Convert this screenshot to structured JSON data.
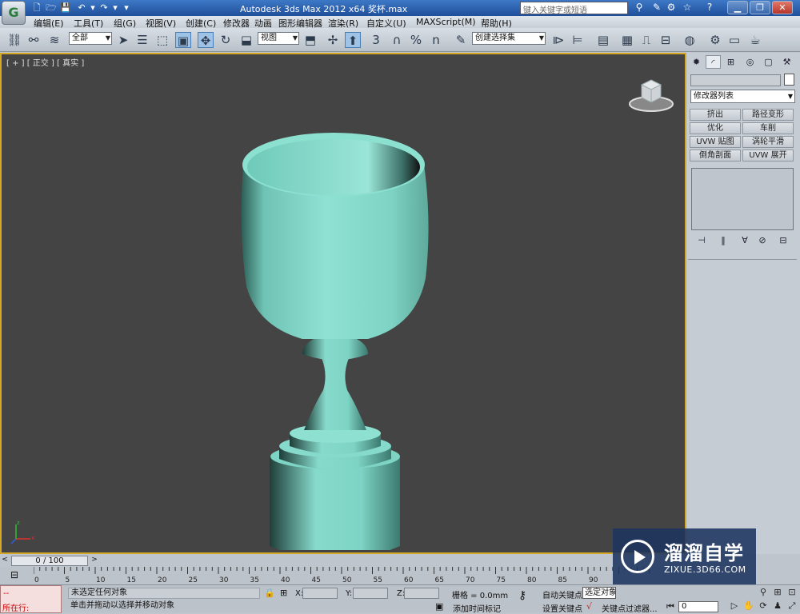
{
  "titlebar": {
    "title": "Autodesk 3ds Max  2012 x64      奖杯.max",
    "search_placeholder": "键入关键字或短语",
    "app_icon_letter": "G"
  },
  "menu": {
    "items": [
      "编辑(E)",
      "工具(T)",
      "组(G)",
      "视图(V)",
      "创建(C)",
      "修改器",
      "动画",
      "图形编辑器",
      "渲染(R)",
      "自定义(U)",
      "MAXScript(M)",
      "帮助(H)"
    ]
  },
  "toolbar": {
    "selection_filter": "全部",
    "coord_system": "视图",
    "named_selection": "创建选择集",
    "snap_3": "3",
    "snap_percent": "%",
    "spinner_snap": "n"
  },
  "viewport": {
    "label": "[ + ] [ 正交 ] [ 真实 ]",
    "object_color": "#7ed4c4",
    "background": "#444444",
    "border_color": "#d4a824"
  },
  "command_panel": {
    "modifier_list": "修改器列表",
    "modifier_buttons": [
      "挤出",
      "路径变形",
      "优化",
      "车削",
      "UVW 贴图",
      "涡轮平滑",
      "倒角剖面",
      "UVW 展开"
    ]
  },
  "timeline": {
    "frame_display": "0 / 100",
    "ticks": [
      "0",
      "5",
      "10",
      "15",
      "20",
      "25",
      "30",
      "35",
      "40",
      "45",
      "50",
      "55",
      "60",
      "65",
      "70",
      "75",
      "80",
      "85",
      "90"
    ]
  },
  "status": {
    "line1": "未选定任何对象",
    "line2": "单击并拖动以选择并移动对象",
    "running": "所在行:",
    "maxscript_dashes": "--",
    "x_label": "X:",
    "y_label": "Y:",
    "z_label": "Z:",
    "grid": "栅格 = 0.0mm",
    "add_time_tag": "添加时间标记",
    "auto_key": "自动关键点",
    "set_key": "设置关键点",
    "selected": "选定对象",
    "key_filters": "关键点过滤器...",
    "frame": "0"
  },
  "watermark": {
    "title": "溜溜自学",
    "url": "ZIXUE.3D66.COM"
  }
}
